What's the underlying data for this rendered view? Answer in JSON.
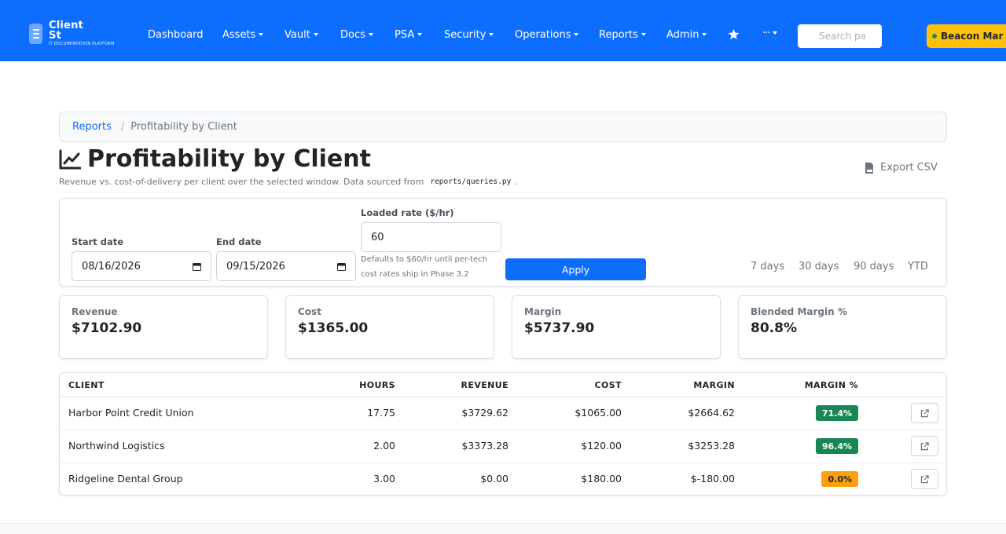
{
  "brand": {
    "name": "Client St",
    "tagline": "IT DOCUMENTATION PLATFORM",
    "logo_icon": "brand-logo-icon"
  },
  "nav": {
    "dashboard": "Dashboard",
    "assets": "Assets",
    "vault": "Vault",
    "docs": "Docs",
    "psa": "PSA",
    "security": "Security",
    "operations": "Operations",
    "reports": "Reports",
    "admin": "Admin",
    "more": "···",
    "star_icon": "star-icon",
    "search_placeholder": "Search pa",
    "client_selector": "Beacon Mar"
  },
  "breadcrumb": {
    "parent": "Reports",
    "current": "Profitability by Client"
  },
  "header": {
    "title": "Profitability by Client",
    "icon": "chart-line-icon",
    "subtitle_before": "Revenue vs. cost-of-delivery per client over the selected window. Data sourced from",
    "subtitle_code": "reports/queries.py",
    "subtitle_after": ".",
    "export_label": "Export CSV"
  },
  "filters": {
    "start_label": "Start date",
    "start_value": "08/16/2026",
    "end_label": "End date",
    "end_value": "09/15/2026",
    "rate_label": "Loaded rate ($/hr)",
    "rate_value": "60",
    "rate_help": "Defaults to $60/hr until per-tech cost rates ship in Phase 3.2",
    "apply_label": "Apply",
    "presets": [
      "7 days",
      "30 days",
      "90 days",
      "YTD"
    ]
  },
  "metrics": [
    {
      "label": "Revenue",
      "value": "$7102.90"
    },
    {
      "label": "Cost",
      "value": "$1365.00"
    },
    {
      "label": "Margin",
      "value": "$5737.90"
    },
    {
      "label": "Blended Margin %",
      "value": "80.8%"
    }
  ],
  "table": {
    "headers": [
      "CLIENT",
      "HOURS",
      "REVENUE",
      "COST",
      "MARGIN",
      "MARGIN %"
    ],
    "rows": [
      {
        "client": "Harbor Point Credit Union",
        "hours": "17.75",
        "revenue": "$3729.62",
        "cost": "$1065.00",
        "margin": "$2664.62",
        "margin_pct": "71.4%"
      },
      {
        "client": "Northwind Logistics",
        "hours": "2.00",
        "revenue": "$3373.28",
        "cost": "$120.00",
        "margin": "$3253.28",
        "margin_pct": "96.4%"
      },
      {
        "client": "Ridgeline Dental Group",
        "hours": "3.00",
        "revenue": "$0.00",
        "cost": "$180.00",
        "margin": "$-180.00",
        "margin_pct": "0.0%"
      }
    ]
  },
  "colors": {
    "primary": "#0d6efd",
    "success": "#198754",
    "warning": "#fd7e14",
    "client_pill": "#ffc107"
  }
}
